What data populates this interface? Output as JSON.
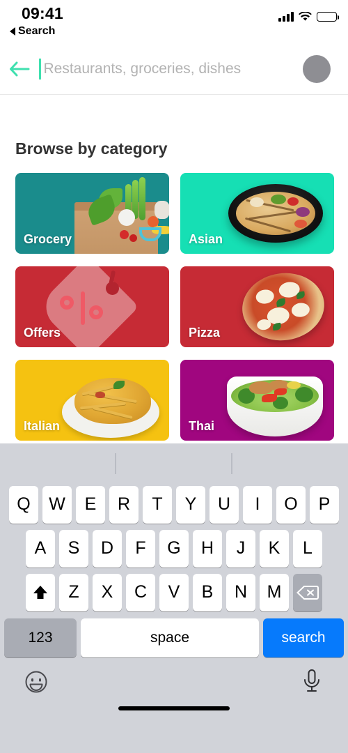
{
  "status_bar": {
    "time": "09:41",
    "back_label": "Search",
    "back_icon": "triangle-left-icon",
    "cellular_icon": "cellular-signal-icon",
    "wifi_icon": "wifi-icon",
    "battery_icon": "battery-full-icon"
  },
  "search_header": {
    "back_arrow_icon": "arrow-left-icon",
    "placeholder": "Restaurants, groceries, dishes",
    "value": "",
    "accent_color": "#3FE0AF",
    "avatar_icon": "avatar-icon",
    "avatar_color": "#8e8e93"
  },
  "main": {
    "section_title": "Browse by category",
    "categories": [
      {
        "label": "Grocery",
        "color": "#1A8C8C",
        "art": "grocery-bag-image"
      },
      {
        "label": "Asian",
        "color": "#16DFB4",
        "art": "noodle-bowl-image"
      },
      {
        "label": "Offers",
        "color": "#C62B35",
        "art": "discount-tag-icon"
      },
      {
        "label": "Pizza",
        "color": "#C62B35",
        "art": "pizza-image"
      },
      {
        "label": "Italian",
        "color": "#F5C211",
        "art": "pasta-image"
      },
      {
        "label": "Thai",
        "color": "#A0067F",
        "art": "salad-bowl-image"
      }
    ]
  },
  "keyboard": {
    "row1": [
      "Q",
      "W",
      "E",
      "R",
      "T",
      "Y",
      "U",
      "I",
      "O",
      "P"
    ],
    "row2": [
      "A",
      "S",
      "D",
      "F",
      "G",
      "H",
      "J",
      "K",
      "L"
    ],
    "row3": [
      "Z",
      "X",
      "C",
      "V",
      "B",
      "N",
      "M"
    ],
    "shift_icon": "shift-arrow-icon",
    "backspace_icon": "backspace-icon",
    "numbers_label": "123",
    "space_label": "space",
    "return_label": "search",
    "return_color": "#067AFC",
    "emoji_icon": "emoji-smiley-icon",
    "mic_icon": "microphone-icon",
    "home_indicator_icon": "home-indicator"
  }
}
